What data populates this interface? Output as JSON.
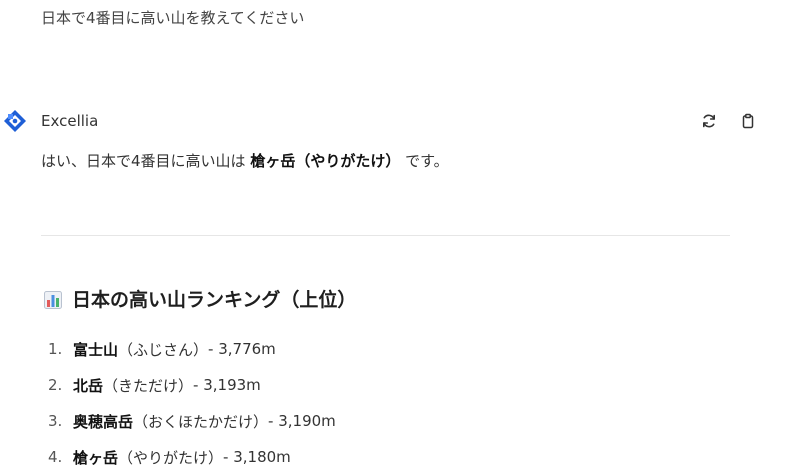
{
  "user_message": "日本で4番目に高い山を教えてください",
  "assistant": {
    "name": "Excellia",
    "answer": {
      "prefix": "はい、日本で4番目に高い山は ",
      "highlight": "槍ヶ岳（やりがたけ）",
      "suffix": " です。"
    },
    "actions": {
      "regenerate_icon": "refresh-icon",
      "copy_icon": "clipboard-icon"
    }
  },
  "ranking": {
    "emoji_icon": "bar-chart-icon",
    "title": "日本の高い山ランキング（上位）",
    "items": [
      {
        "number": "1.",
        "name": "富士山",
        "reading": "（ふじさん）",
        "height": " - 3,776m"
      },
      {
        "number": "2.",
        "name": "北岳",
        "reading": "（きただけ）",
        "height": " - 3,193m"
      },
      {
        "number": "3.",
        "name": "奥穂高岳",
        "reading": "（おくほたかだけ）",
        "height": " - 3,190m"
      },
      {
        "number": "4.",
        "name": "槍ヶ岳",
        "reading": "（やりがたけ）",
        "height": " - 3,180m"
      }
    ]
  },
  "colors": {
    "logo_blue": "#1f5fd6",
    "logo_light": "#4f8dff",
    "text": "#333333"
  }
}
